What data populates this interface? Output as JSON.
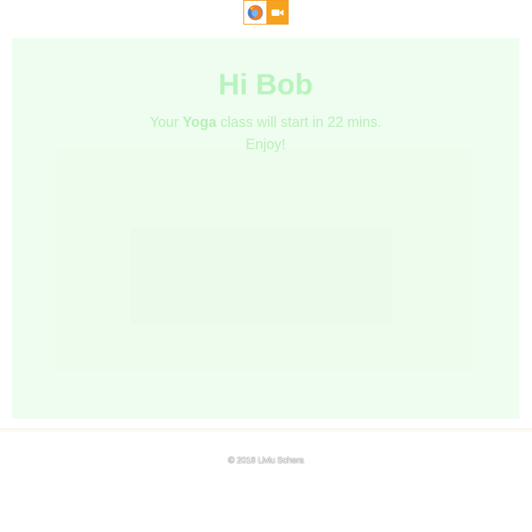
{
  "toolbar": {
    "browser_icon": "firefox-icon",
    "video_icon": "video-camera-icon",
    "accent_color": "#f5a31f"
  },
  "hero": {
    "greeting": "Hi Bob",
    "message_prefix": "Your ",
    "class_name": "Yoga",
    "message_suffix": " class will start in 22 mins.",
    "message_line2": "Enjoy!",
    "background_color": "#eefdef",
    "text_color": "#b9f3be"
  },
  "footer": {
    "copyright": "© 2018 Liviu Schera"
  }
}
